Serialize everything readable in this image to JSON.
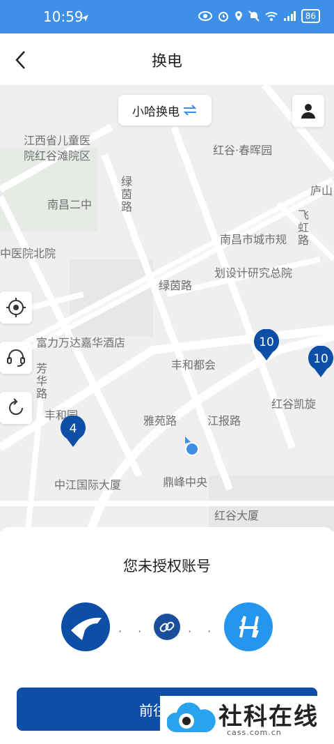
{
  "status_bar": {
    "time": "10:59",
    "battery": "86",
    "icons": [
      "send-icon",
      "eye-icon",
      "alarm-icon",
      "location-icon",
      "mute-icon",
      "wifi-icon",
      "signal-icon",
      "battery-icon"
    ]
  },
  "header": {
    "title": "换电",
    "back_icon": "chevron-left-icon"
  },
  "map": {
    "brand_switch": {
      "label": "小哈换电",
      "icon": "swap-arrows-icon"
    },
    "labels": {
      "l1": "江西省儿童医",
      "l2": "院红谷滩院区",
      "l3": "红谷·春晖园",
      "l4": "绿茵路",
      "l5": "南昌二中",
      "l6": "庐山",
      "l7": "飞虹路",
      "l8": "中医院北院",
      "l9": "南昌市城市规",
      "l10": "划设计研究总院",
      "l11": "绿茵路",
      "l12": "富力万达嘉华酒店",
      "l13": "丰和都会",
      "l14": "芳华路",
      "l15": "丰和园",
      "l16": "红谷凯旋",
      "l17": "雅苑路",
      "l18": "江报路",
      "l19": "中江国际大厦",
      "l20": "鼎峰中央",
      "l21": "红谷大厦"
    },
    "markers": [
      {
        "name": "marker-a",
        "count": "10"
      },
      {
        "name": "marker-b",
        "count": "10"
      },
      {
        "name": "marker-c",
        "count": "4"
      }
    ],
    "controls": [
      "user-icon",
      "locate-icon",
      "customer-service-icon",
      "refresh-icon"
    ],
    "colors": {
      "map_bg": "#efefef",
      "road": "#ffffff",
      "marker": "#0d4ea6",
      "user_dot": "#3d8fe8"
    }
  },
  "sheet": {
    "title": "您未授权账号",
    "left_logo": "airline-logo-icon",
    "right_logo": "haluo-logo-icon",
    "link_icon": "link-icon",
    "dots": "· · ·",
    "button_label": "前往授权"
  },
  "watermark": {
    "text": "社科在线",
    "url": "cass.com.cn"
  },
  "colors": {
    "status_bar": "#3d8fe8",
    "accent_dark": "#0d4ea6",
    "accent_light": "#2596ee"
  }
}
